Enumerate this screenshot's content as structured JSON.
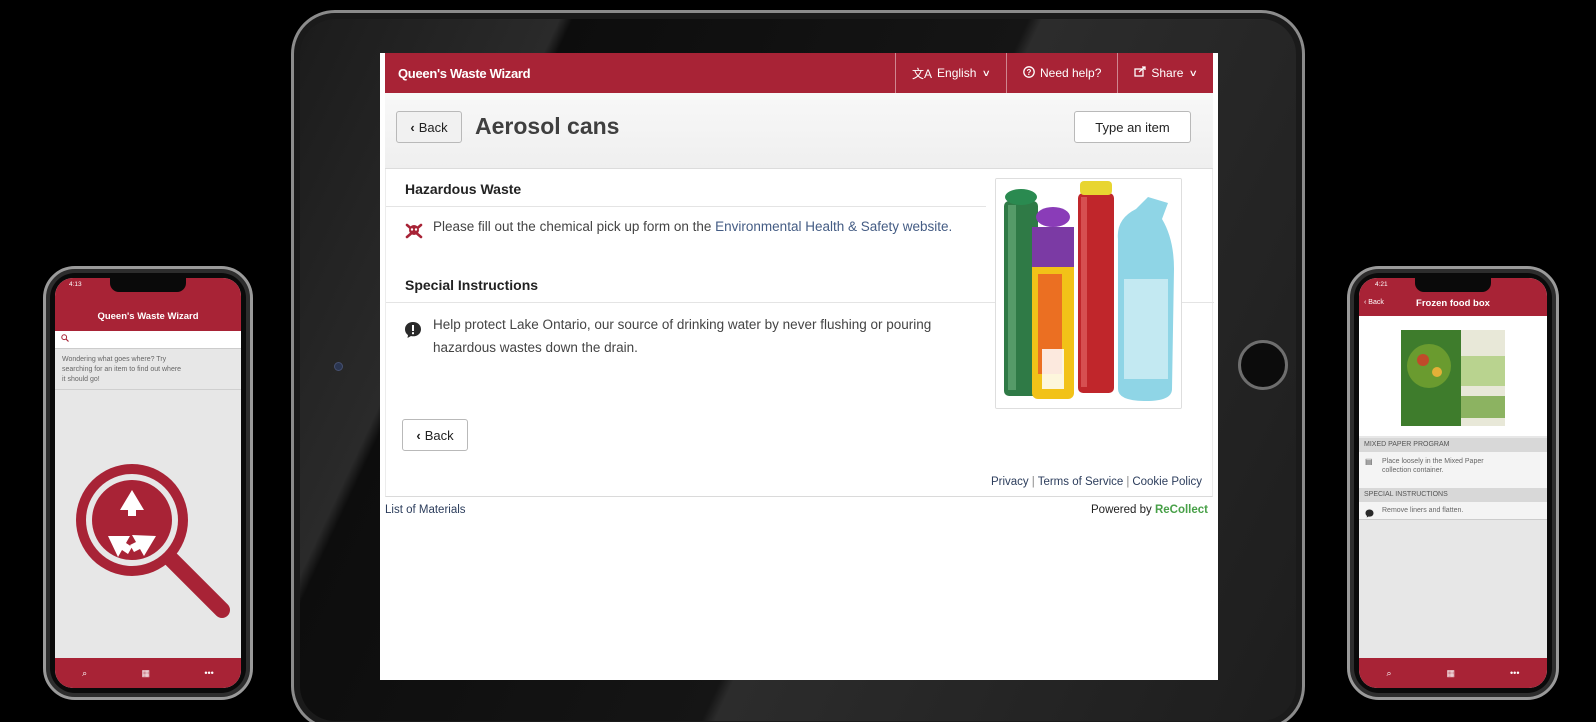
{
  "tablet": {
    "app_title": "Queen's Waste Wizard",
    "header_buttons": {
      "language": {
        "icon": "translate-icon",
        "label": "English"
      },
      "help": {
        "icon": "question-circle-icon",
        "label": "Need help?"
      },
      "share": {
        "icon": "share-icon",
        "label": "Share"
      }
    },
    "back_label": "Back",
    "page_title": "Aerosol cans",
    "search_button_label": "Type an item",
    "sections": [
      {
        "title": "Hazardous Waste",
        "icon": "skull-crossbones-icon",
        "text_before_link": "Please fill out the chemical pick up form on the ",
        "link_text": "Environmental Health & Safety website",
        "text_after_link": "."
      },
      {
        "title": "Special Instructions",
        "icon": "exclamation-bubble-icon",
        "line1": "Help protect Lake Ontario, our source of drinking water by never flushing or pouring",
        "line2": "hazardous wastes down the drain."
      }
    ],
    "bottom_back_label": "Back",
    "footer": {
      "privacy": "Privacy",
      "terms": "Terms of Service",
      "cookie": "Cookie Policy",
      "list_of_materials": "List of Materials",
      "powered_by": "Powered by",
      "brand": "ReCollect"
    },
    "colors": {
      "brand_red": "#a82336",
      "link": "#445c84",
      "recollect_green": "#48a048"
    }
  },
  "left_phone": {
    "time": "4:13",
    "title": "Queen's Waste Wizard",
    "search_icon": "search-icon",
    "hint_line1": "Wondering what goes where? Try",
    "hint_line2": "searching for an item to find out where",
    "hint_line3": "it should go!",
    "tabs": [
      "search-icon",
      "calendar-icon",
      "more-icon"
    ]
  },
  "right_phone": {
    "time": "4:21",
    "back_label": "Back",
    "title": "Frozen food box",
    "section1": "MIXED PAPER PROGRAM",
    "item1_line1": "Place loosely in the Mixed Paper",
    "item1_line2": "collection container.",
    "section2": "SPECIAL INSTRUCTIONS",
    "item2": "Remove liners and flatten.",
    "tabs": [
      "search-icon",
      "calendar-icon",
      "more-icon"
    ]
  }
}
